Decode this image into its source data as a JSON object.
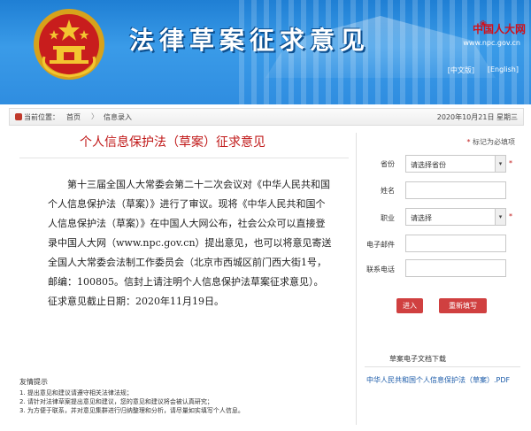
{
  "header": {
    "site_title": "法律草案征求意见",
    "brand_name": "中国人大网",
    "brand_url": "www.npc.gov.cn",
    "lang_cn": "[中文版]",
    "lang_en": "[English]"
  },
  "breadcrumb": {
    "current_label": "当前位置：",
    "home": "首页",
    "separator": "〉",
    "page": "信息录入",
    "date": "2020年10月21日 星期三"
  },
  "article": {
    "title": "个人信息保护法（草案）征求意见",
    "body": "第十三届全国人大常委会第二十二次会议对《中华人民共和国个人信息保护法（草案）》进行了审议。现将《中华人民共和国个人信息保护法（草案）》在中国人大网公布，社会公众可以直接登录中国人大网（www.npc.gov.cn）提出意见，也可以将意见寄送全国人大常委会法制工作委员会（北京市西城区前门西大街1号，邮编：100805。信封上请注明个人信息保护法草案征求意见）。征求意见截止日期：2020年11月19日。"
  },
  "tips": {
    "heading": "友情提示",
    "items": [
      "1. 提出意见和建议请遵守相关法律法规；",
      "2. 请针对法律草案提出意见和建议，您的意见和建议将会被认真研究；",
      "3. 为方便于联系，并对意见集群进行归纳整理和分析，请尽量如实填写个人信息。"
    ]
  },
  "form": {
    "required_note_star": "*",
    "required_note": "标记为必填项",
    "province_label": "省份",
    "province_value": "请选择省份",
    "name_label": "姓名",
    "occupation_label": "职业",
    "occupation_value": "请选择",
    "email_label": "电子邮件",
    "phone_label": "联系电话",
    "required_star": "*",
    "submit_label": "进入",
    "reset_label": "重新填写"
  },
  "download": {
    "heading": "草案电子文档下载",
    "link": "中华人民共和国个人信息保护法（草案）.PDF"
  },
  "colors": {
    "header_blue": "#2f8de0",
    "title_red": "#c01818",
    "button_red": "#d04040",
    "link_blue": "#1a5aa8"
  }
}
